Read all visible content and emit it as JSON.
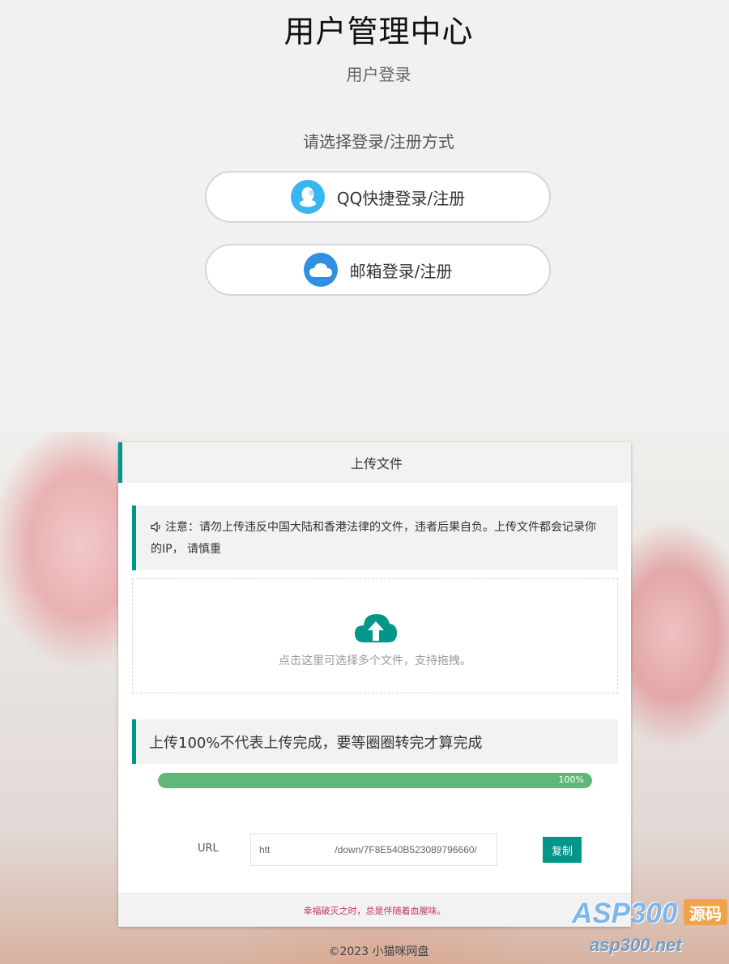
{
  "header": {
    "title": "用户管理中心",
    "subtitle": "用户登录",
    "prompt": "请选择登录/注册方式"
  },
  "login_options": [
    {
      "label": "QQ快捷登录/注册",
      "icon": "qq-icon",
      "color": "#38b6f0"
    },
    {
      "label": "邮箱登录/注册",
      "icon": "cloud-mail-icon",
      "color": "#2f8fe0"
    }
  ],
  "upload_card": {
    "title": "上传文件",
    "notice": "注意：请勿上传违反中国大陆和香港法律的文件，违者后果自负。上传文件都会记录你的IP， 请慎重",
    "drop_hint": "点击这里可选择多个文件，支持拖拽。",
    "tip": "上传100%不代表上传完成，要等圈圈转完才算完成",
    "progress": {
      "value": 100,
      "label": "100%"
    },
    "url_label": "URL",
    "url_value": "htt                        /down/7F8E540B523089796660/",
    "copy_label": "复制",
    "footer": "幸福破灭之时，总是伴随着血腥味。"
  },
  "copyright": "©2023 小猫咪网盘",
  "watermark": {
    "brand": "ASP300",
    "badge": "源码",
    "domain": "asp300.net"
  },
  "colors": {
    "accent": "#009688",
    "progress": "#5fb878",
    "footer_text": "#c0395b"
  }
}
